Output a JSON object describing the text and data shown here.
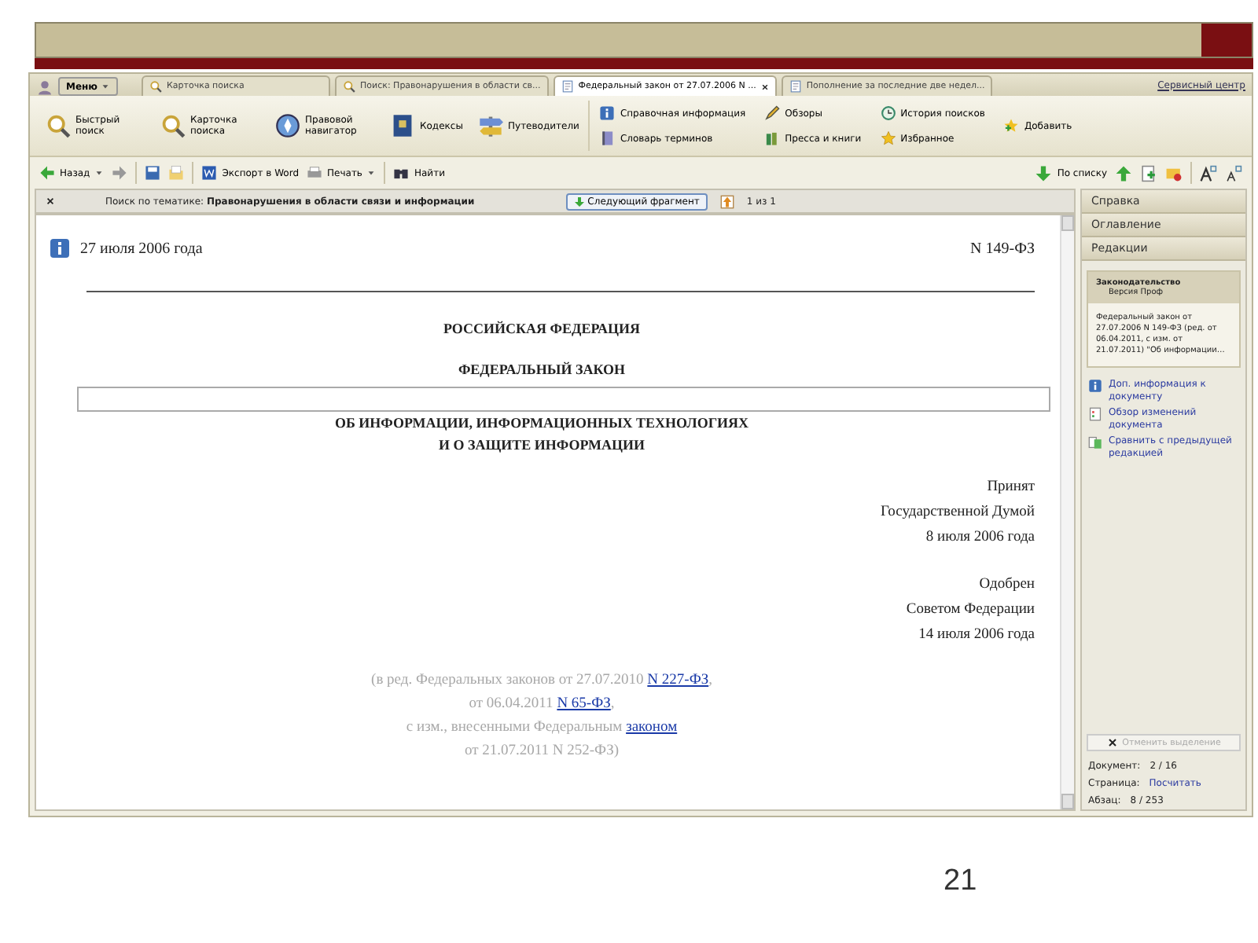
{
  "slide_number": "21",
  "app": {
    "menu_button": "Меню",
    "tabs": [
      {
        "label": "Карточка поиска",
        "selected": false
      },
      {
        "label": "Поиск: Правонарушения в области св...",
        "selected": false
      },
      {
        "label": "Федеральный закон от 27.07.2006 N ...",
        "selected": true
      },
      {
        "label": "Пополнение за последние две недел...",
        "selected": false
      }
    ],
    "service_link": "Сервисный центр",
    "ribbon_large": [
      "Быстрый поиск",
      "Карточка поиска",
      "Правовой навигатор",
      "Кодексы",
      "Путеводители"
    ],
    "ribbon_small": [
      [
        "Справочная информация",
        "Словарь терминов"
      ],
      [
        "Обзоры",
        "Пресса и книги"
      ],
      [
        "История поисков",
        "Избранное"
      ],
      [
        "Добавить"
      ]
    ],
    "nav_toolbar": {
      "back": "Назад",
      "export": "Экспорт в Word",
      "print": "Печать",
      "find": "Найти",
      "by_list": "По списку"
    },
    "search_bar": {
      "label": "Поиск по тематике:",
      "topic": "Правонарушения в области связи и информации",
      "next_button": "Следующий фрагмент",
      "counter": "1 из 1"
    },
    "document": {
      "date": "27 июля 2006 года",
      "number": "N 149-ФЗ",
      "headings": [
        "РОССИЙСКАЯ ФЕДЕРАЦИЯ",
        "ФЕДЕРАЛЬНЫЙ ЗАКОН"
      ],
      "title_lines": [
        "ОБ ИНФОРМАЦИИ, ИНФОРМАЦИОННЫХ ТЕХНОЛОГИЯХ",
        "И О ЗАЩИТЕ ИНФОРМАЦИИ"
      ],
      "adoption": [
        [
          "Принят",
          "Государственной Думой",
          "8 июля 2006 года"
        ],
        [
          "Одобрен",
          "Советом Федерации",
          "14 июля 2006 года"
        ]
      ],
      "editions": [
        {
          "text": "(в ред. Федеральных законов от 27.07.2010 ",
          "link": "N 227-ФЗ",
          "after": ","
        },
        {
          "text": "от 06.04.2011 ",
          "link": "N 65-ФЗ",
          "after": ","
        },
        {
          "text": "с изм., внесенными Федеральным ",
          "link": "законом"
        },
        {
          "text": "от 21.07.2011 N 252-ФЗ)"
        }
      ]
    },
    "side_panel": {
      "tabs": [
        "Справка",
        "Оглавление",
        "Редакции"
      ],
      "card": {
        "header": "Законодательство",
        "subheader": "Версия Проф",
        "body": "Федеральный закон от 27.07.2006 N 149-ФЗ (ред. от 06.04.2011, с изм. от 21.07.2011) \"Об информации…"
      },
      "links": [
        "Доп. информация к документу",
        "Обзор изменений документа",
        "Сравнить с предыдущей редакцией"
      ],
      "clear_button": {
        "label": "Отменить выделение",
        "disabled": true
      },
      "status": [
        {
          "label": "Документ:",
          "value": "2 / 16",
          "kind": "text"
        },
        {
          "label": "Страница:",
          "value": "Посчитать",
          "kind": "link"
        },
        {
          "label": "Абзац:",
          "value": "8 / 253",
          "kind": "text"
        }
      ]
    }
  }
}
